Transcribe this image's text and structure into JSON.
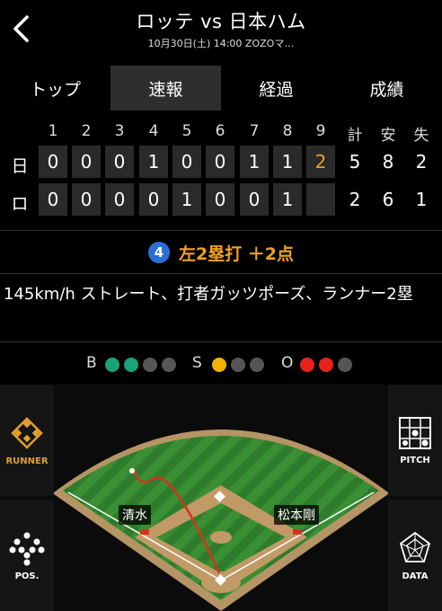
{
  "header": {
    "title": "ロッテ vs 日本ハム",
    "subtitle": "10月30日(土) 14:00 ZOZOマ…"
  },
  "tabs": [
    {
      "label": "トップ",
      "active": false
    },
    {
      "label": "速報",
      "active": true
    },
    {
      "label": "経過",
      "active": false
    },
    {
      "label": "成績",
      "active": false
    }
  ],
  "scoreboard": {
    "innings": [
      "1",
      "2",
      "3",
      "4",
      "5",
      "6",
      "7",
      "8",
      "9"
    ],
    "totals_headers": [
      "計",
      "安",
      "失"
    ],
    "rows": [
      {
        "team": "日",
        "scores": [
          "0",
          "0",
          "0",
          "1",
          "0",
          "0",
          "1",
          "1",
          "2"
        ],
        "totals": [
          "5",
          "8",
          "2"
        ]
      },
      {
        "team": "ロ",
        "scores": [
          "0",
          "0",
          "0",
          "0",
          "1",
          "0",
          "0",
          "1",
          ""
        ],
        "totals": [
          "2",
          "6",
          "1"
        ]
      }
    ]
  },
  "play": {
    "inning": "4",
    "label": "左2塁打 ＋2点",
    "description": "145km/h ストレート、打者ガッツポーズ、ランナー2塁"
  },
  "count": {
    "ball_label": "B",
    "strike_label": "S",
    "out_label": "O",
    "balls": 2,
    "strikes": 1,
    "outs": 2,
    "ball_color": "#1aa37a",
    "strike_color": "#f2b400",
    "out_color": "#e8231c"
  },
  "side_buttons": {
    "runner": "RUNNER",
    "pos": "POS.",
    "pitch": "PITCH",
    "data": "DATA"
  },
  "field": {
    "runner_left": "清水",
    "runner_right": "松本剛"
  }
}
